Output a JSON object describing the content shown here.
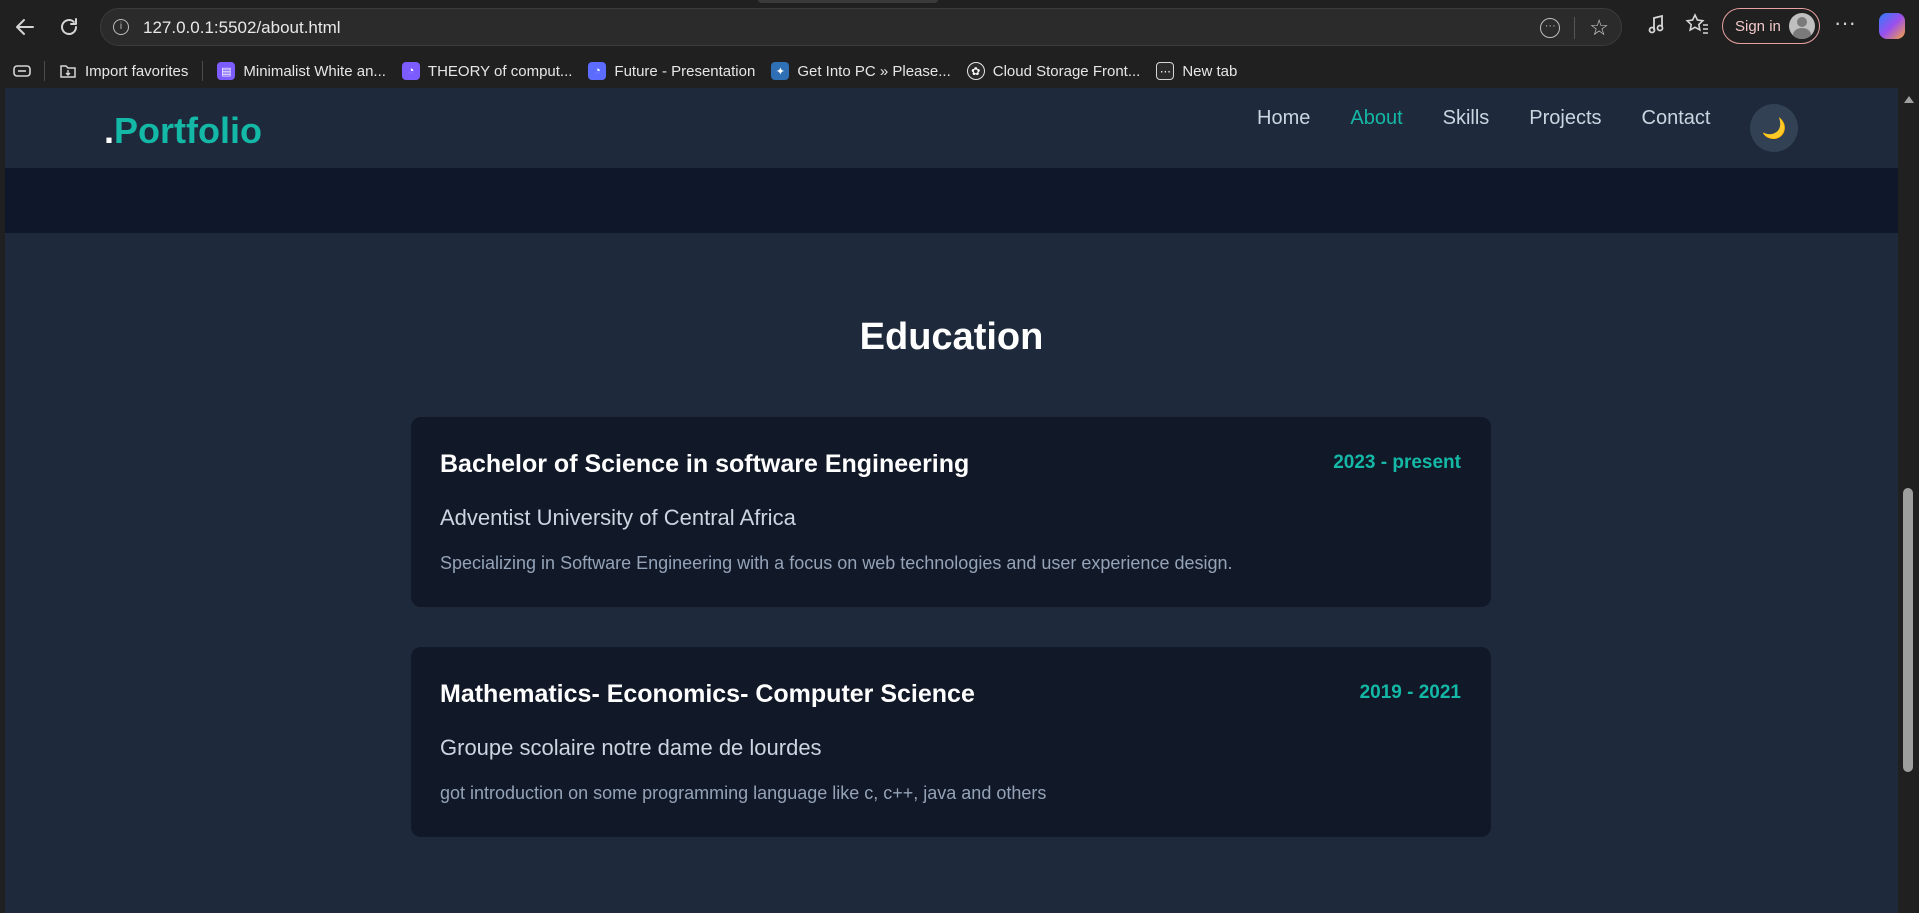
{
  "browser": {
    "url": "127.0.0.1:5502/about.html",
    "signin_label": "Sign in",
    "bookmarks": [
      {
        "label": "Import favorites",
        "icon": "import-icon",
        "color": "#3a3a3a"
      },
      {
        "label": "Minimalist White an...",
        "icon": "canva-icon",
        "color": "#7c5cff"
      },
      {
        "label": "THEORY of comput...",
        "icon": "canva-icon",
        "color": "#7c5cff"
      },
      {
        "label": "Future - Presentation",
        "icon": "canva-icon",
        "color": "#5b6cff"
      },
      {
        "label": "Get Into PC » Please...",
        "icon": "getintopc-icon",
        "color": "#2e6fb5"
      },
      {
        "label": "Cloud Storage Front...",
        "icon": "chatgpt-icon",
        "color": "#2b2b2b"
      },
      {
        "label": "New tab",
        "icon": "newtab-icon",
        "color": "#2b2b2b"
      }
    ]
  },
  "site": {
    "brand_dot": ".",
    "brand_name": "Portfolio",
    "nav": [
      {
        "label": "Home",
        "active": false
      },
      {
        "label": "About",
        "active": true
      },
      {
        "label": "Skills",
        "active": false
      },
      {
        "label": "Projects",
        "active": false
      },
      {
        "label": "Contact",
        "active": false
      }
    ],
    "theme_icon": "🌙",
    "accent_color": "#14b8a6"
  },
  "education": {
    "title": "Education",
    "items": [
      {
        "degree": "Bachelor of Science in software Engineering",
        "years": "2023 - present",
        "school": "Adventist University of Central Africa",
        "description": "Specializing in Software Engineering with a focus on web technologies and user experience design."
      },
      {
        "degree": "Mathematics- Economics- Computer Science",
        "years": "2019 - 2021",
        "school": "Groupe scolaire notre dame de lourdes",
        "description": "got introduction on some programming language like c, c++, java and others"
      }
    ]
  }
}
